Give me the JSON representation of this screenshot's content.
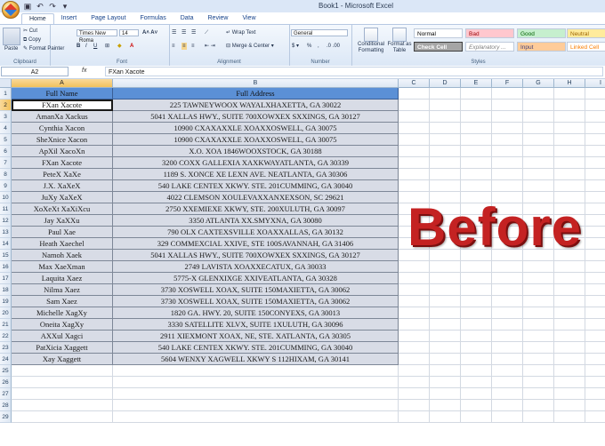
{
  "window": {
    "title": "Book1 - Microsoft Excel"
  },
  "ribbon": {
    "tabs": [
      "Home",
      "Insert",
      "Page Layout",
      "Formulas",
      "Data",
      "Review",
      "View"
    ],
    "clipboard": {
      "label": "Clipboard",
      "paste": "Paste",
      "cut": "Cut",
      "copy": "Copy",
      "format_painter": "Format Painter"
    },
    "font": {
      "label": "Font",
      "name": "Times New Roma",
      "size": "14"
    },
    "alignment": {
      "label": "Alignment",
      "wrap_text": "Wrap Text",
      "merge_center": "Merge & Center"
    },
    "number": {
      "label": "Number",
      "format": "General"
    },
    "styles": {
      "label": "Styles",
      "conditional": "Conditional Formatting",
      "format_as_table": "Format as Table",
      "cells": [
        {
          "name": "Normal",
          "bg": "#ffffff",
          "fg": "#000000"
        },
        {
          "name": "Bad",
          "bg": "#ffc7ce",
          "fg": "#9c0006"
        },
        {
          "name": "Good",
          "bg": "#c6efce",
          "fg": "#006100"
        },
        {
          "name": "Neutral",
          "bg": "#ffeb9c",
          "fg": "#9c6500"
        },
        {
          "name": "Check Cell",
          "bg": "#a5a5a5",
          "fg": "#ffffff"
        },
        {
          "name": "Explanatory ...",
          "bg": "#ffffff",
          "fg": "#7f7f7f"
        },
        {
          "name": "Input",
          "bg": "#ffcc99",
          "fg": "#3f3f76"
        },
        {
          "name": "Linked Cell",
          "bg": "#ffffff",
          "fg": "#fa7d00"
        }
      ]
    }
  },
  "formula_bar": {
    "name_box": "A2",
    "fx": "fx",
    "content": "FXan Xacote"
  },
  "sheet": {
    "columns": [
      "A",
      "B",
      "C",
      "D",
      "E",
      "F",
      "G",
      "H",
      "I"
    ],
    "rows": [
      "1",
      "2",
      "3",
      "4",
      "5",
      "6",
      "7",
      "8",
      "9",
      "10",
      "11",
      "12",
      "13",
      "14",
      "15",
      "16",
      "17",
      "18",
      "19",
      "20",
      "21",
      "22",
      "23",
      "24",
      "25",
      "26",
      "27",
      "28",
      "29"
    ],
    "header": [
      "Full Name",
      "Full Address"
    ],
    "data": [
      [
        "FXan Xacote",
        "225 TAWNEYWOOX WAYALXHAXETTA, GA 30022"
      ],
      [
        "AmanXa Xackus",
        "5041 XALLAS HWY., SUITE 700XOWXEX SXXINGS, GA 30127"
      ],
      [
        "Cynthia Xacon",
        "10900 CXAXAXXLE XOAXXOSWELL, GA 30075"
      ],
      [
        "SheXnice Xacon",
        "10900 CXAXAXXLE XOAXXOSWELL, GA 30075"
      ],
      [
        "ApXil XacoXn",
        "X.O. XOA 1846WOOXSTOCK, GA 30188"
      ],
      [
        "FXan Xacote",
        "3200 COXX GALLEXIA XAXKWAYATLANTA, GA 30339"
      ],
      [
        "PeteX XaXe",
        "1189 S. XONCE XE LEXN AVE. NEATLANTA, GA 30306"
      ],
      [
        "J.X. XaXeX",
        "540 LAKE CENTEX XKWY. STE. 201CUMMING, GA 30040"
      ],
      [
        "JuXy XaXeX",
        "4022 CLEMSON XOULEVAXXANXEXSON, SC 29621"
      ],
      [
        "XoXeXt XaXiXcu",
        "2750 XXEMIEXE XKWY, STE. 200XULUTH, GA 30097"
      ],
      [
        "Jay XaXXu",
        "3350 ATLANTA XX.SMYXNA, GA 30080"
      ],
      [
        "Paul Xae",
        "790 OLX CAXTEXSVILLE XOAXXALLAS, GA 30132"
      ],
      [
        "Heath Xaechel",
        "329 COMMEXCIAL XXIVE, STE 100SAVANNAH, GA 31406"
      ],
      [
        "Namoh Xaek",
        "5041 XALLAS HWY., SUITE 700XOWXEX SXXINGS, GA 30127"
      ],
      [
        "Max XaeXman",
        "2749 LAVISTA XOAXXECATUX, GA 30033"
      ],
      [
        "Laquita Xaez",
        "5775-X GLENXIXGE XXIVEATLANTA, GA 30328"
      ],
      [
        "Nilma Xaez",
        "3730 XOSWELL XOAX, SUITE 150MAXIETTA, GA 30062"
      ],
      [
        "Sam Xaez",
        "3730 XOSWELL XOAX, SUITE 150MAXIETTA, GA 30062"
      ],
      [
        "Michelle XagXy",
        "1820 GA. HWY. 20, SUITE 150CONYEXS, GA 30013"
      ],
      [
        "Oneita XagXy",
        "3330 SATELLITE XLVX, SUITE 1XULUTH, GA 30096"
      ],
      [
        "AXXul Xagci",
        "2911 XIEXMONT XOAX, NE, STE. XATLANTA, GA 30305"
      ],
      [
        "PatXicia Xaggett",
        "540 LAKE CENTEX XKWY. STE. 201CUMMING, GA 30040"
      ],
      [
        "Xay Xaggett",
        "5604 WENXY XAGWELL XKWY S 112HIXAM, GA 30141"
      ]
    ]
  },
  "overlay": {
    "text": "Before",
    "color": "#c42222"
  }
}
